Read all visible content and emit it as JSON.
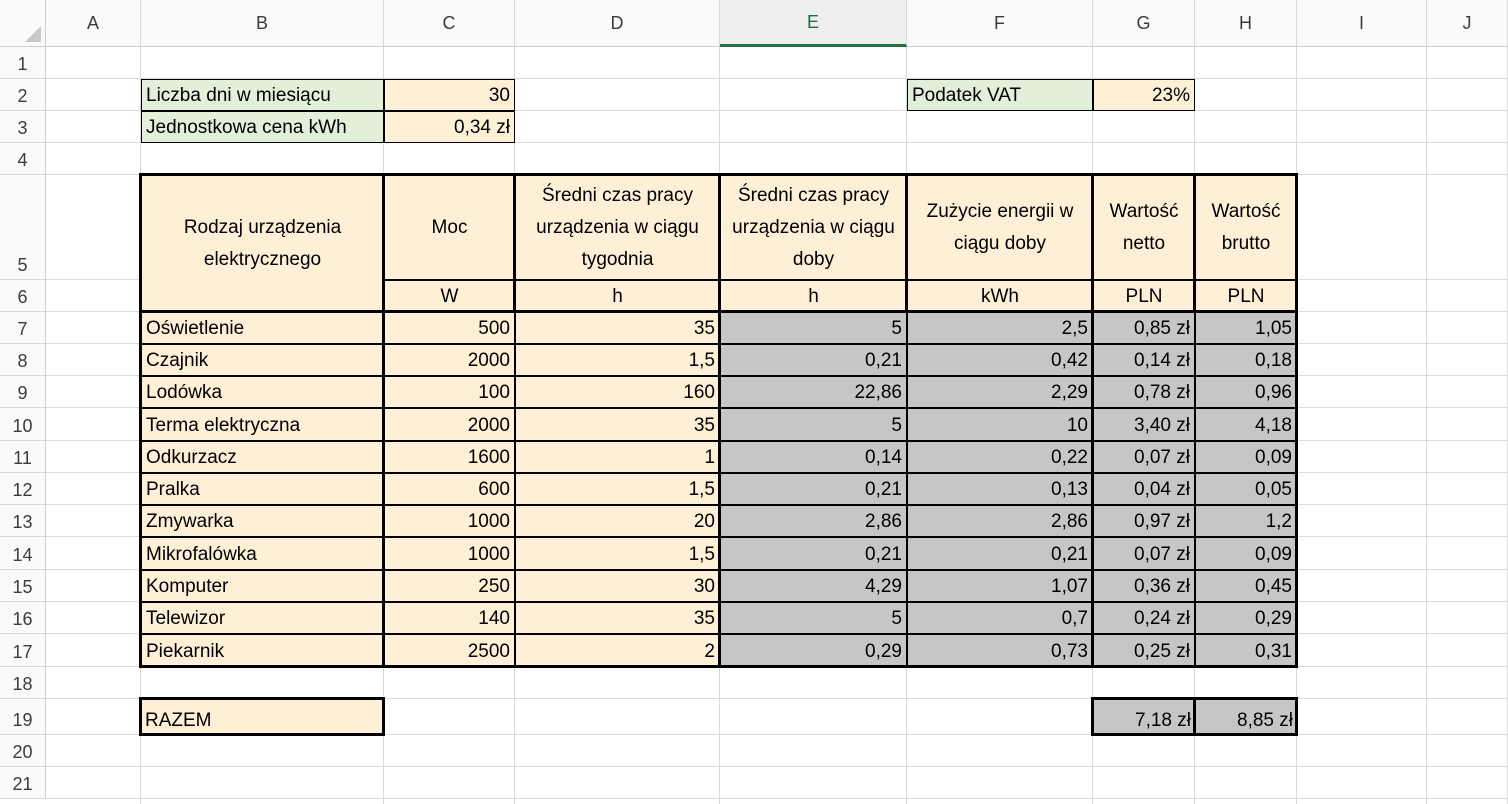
{
  "columns": [
    "A",
    "B",
    "C",
    "D",
    "E",
    "F",
    "G",
    "H",
    "I",
    "J"
  ],
  "selected_column": "E",
  "rows": [
    "1",
    "2",
    "3",
    "4",
    "5",
    "6",
    "7",
    "8",
    "9",
    "10",
    "11",
    "12",
    "13",
    "14",
    "15",
    "16",
    "17",
    "18",
    "19",
    "20",
    "21"
  ],
  "params": {
    "days_label": "Liczba dni w miesiącu",
    "days_value": "30",
    "price_label": "Jednostkowa cena kWh",
    "price_value": "0,34 zł",
    "vat_label": "Podatek VAT",
    "vat_value": "23%"
  },
  "table": {
    "headers": [
      "Rodzaj urządzenia elektrycznego",
      "Moc",
      "Średni czas pracy urządzenia w ciągu tygodnia",
      "Średni czas pracy urządzenia w ciągu doby",
      "Zużycie energii w ciągu doby",
      "Wartość netto",
      "Wartość brutto"
    ],
    "units": [
      "",
      "W",
      "h",
      "h",
      "kWh",
      "PLN",
      "PLN"
    ],
    "rows": [
      [
        "Oświetlenie",
        "500",
        "35",
        "5",
        "2,5",
        "0,85 zł",
        "1,05"
      ],
      [
        "Czajnik",
        "2000",
        "1,5",
        "0,21",
        "0,42",
        "0,14 zł",
        "0,18"
      ],
      [
        "Lodówka",
        "100",
        "160",
        "22,86",
        "2,29",
        "0,78 zł",
        "0,96"
      ],
      [
        "Terma elektryczna",
        "2000",
        "35",
        "5",
        "10",
        "3,40 zł",
        "4,18"
      ],
      [
        "Odkurzacz",
        "1600",
        "1",
        "0,14",
        "0,22",
        "0,07 zł",
        "0,09"
      ],
      [
        "Pralka",
        "600",
        "1,5",
        "0,21",
        "0,13",
        "0,04 zł",
        "0,05"
      ],
      [
        "Zmywarka",
        "1000",
        "20",
        "2,86",
        "2,86",
        "0,97 zł",
        "1,2"
      ],
      [
        "Mikrofalówka",
        "1000",
        "1,5",
        "0,21",
        "0,21",
        "0,07 zł",
        "0,09"
      ],
      [
        "Komputer",
        "250",
        "30",
        "4,29",
        "1,07",
        "0,36 zł",
        "0,45"
      ],
      [
        "Telewizor",
        "140",
        "35",
        "5",
        "0,7",
        "0,24 zł",
        "0,29"
      ],
      [
        "Piekarnik",
        "2500",
        "2",
        "0,29",
        "0,73",
        "0,25 zł",
        "0,31"
      ]
    ]
  },
  "totals": {
    "label": "RAZEM",
    "net": "7,18 zł",
    "gross": "8,85 zł"
  },
  "colors": {
    "cream": "#fdf0d7",
    "green": "#e2efda",
    "gray": "#c6c6c6",
    "selected_column_accent": "#217346"
  }
}
